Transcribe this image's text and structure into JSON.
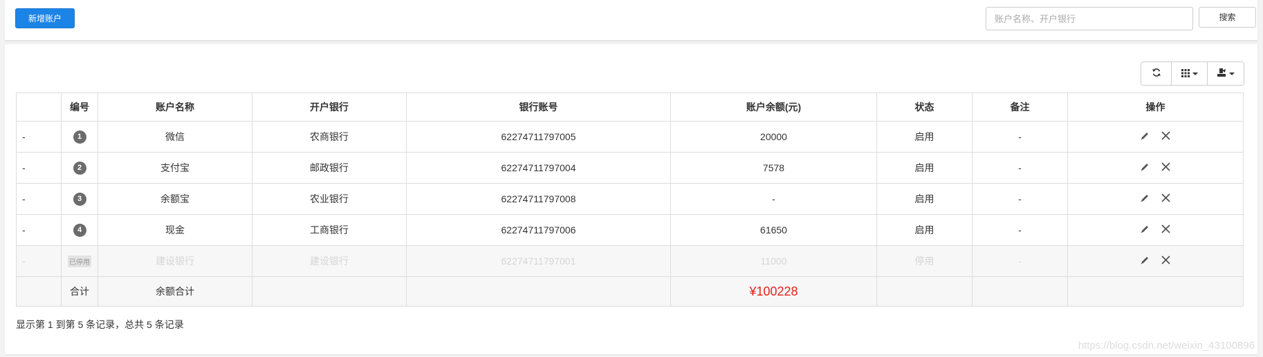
{
  "top": {
    "add_button": "新增账户",
    "search_placeholder": "账户名称、开户银行",
    "search_button": "搜索"
  },
  "toolbar": {
    "icons": [
      "refresh-icon",
      "columns-grid-icon",
      "export-icon"
    ]
  },
  "table": {
    "columns": [
      "",
      "编号",
      "账户名称",
      "开户银行",
      "银行账号",
      "账户余额(元)",
      "状态",
      "备注",
      "操作"
    ],
    "rows": [
      {
        "first": "-",
        "num": "1",
        "name": "微信",
        "bank": "农商银行",
        "account": "62274711797005",
        "balance": "20000",
        "status": "启用",
        "note": "-"
      },
      {
        "first": "-",
        "num": "2",
        "name": "支付宝",
        "bank": "邮政银行",
        "account": "62274711797004",
        "balance": "7578",
        "status": "启用",
        "note": "-"
      },
      {
        "first": "-",
        "num": "3",
        "name": "余额宝",
        "bank": "农业银行",
        "account": "62274711797008",
        "balance": "-",
        "status": "启用",
        "note": "-"
      },
      {
        "first": "-",
        "num": "4",
        "name": "现金",
        "bank": "工商银行",
        "account": "62274711797006",
        "balance": "61650",
        "status": "启用",
        "note": "-"
      }
    ],
    "disabled_row": {
      "first": "-",
      "tag": "已停用",
      "name": "建设银行",
      "bank": "建设银行",
      "account": "62274711797001",
      "balance": "11000",
      "status": "停用",
      "note": "-"
    },
    "total_row": {
      "label_num": "合计",
      "label_name": "余额合计",
      "value": "¥100228"
    }
  },
  "footer": {
    "info": "显示第 1 到第 5 条记录，总共 5 条记录"
  },
  "watermark": "https://blog.csdn.net/weixin_43100896",
  "colors": {
    "primary": "#1c84e6",
    "total_red": "#e4211c"
  }
}
